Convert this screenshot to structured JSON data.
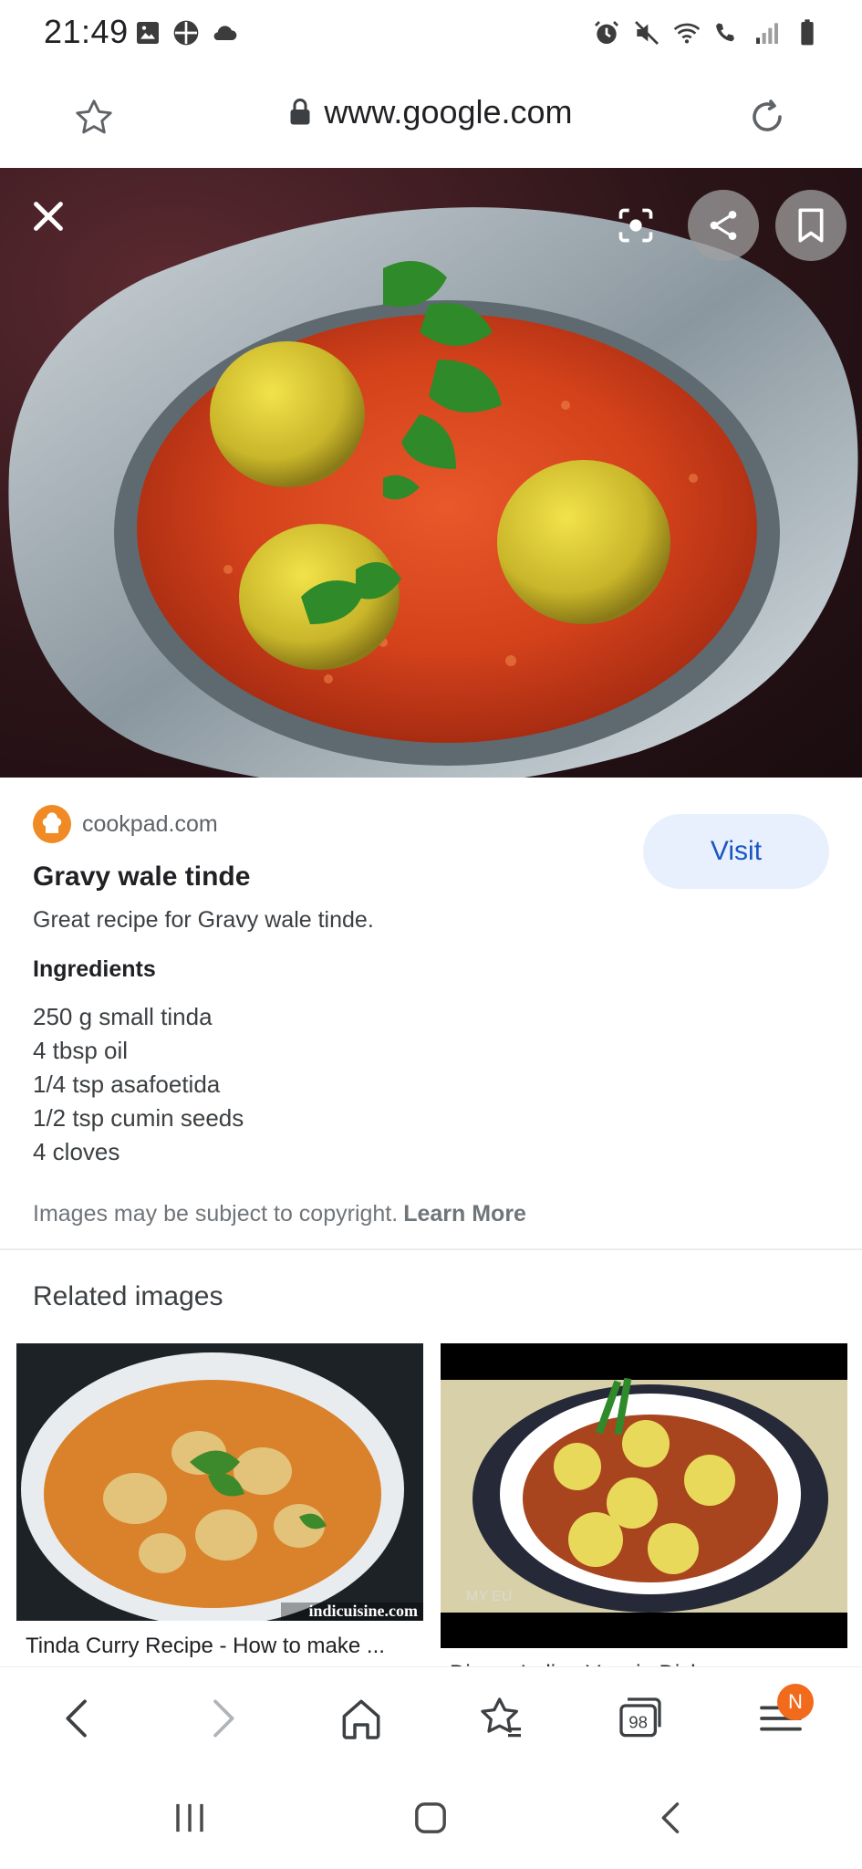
{
  "status_bar": {
    "time": "21:49",
    "icons": [
      "image-icon",
      "game-icon",
      "cloud-icon",
      "alarm-icon",
      "mute-icon",
      "wifi-icon",
      "wifi-call-icon",
      "signal-icon",
      "battery-icon"
    ]
  },
  "url_bar": {
    "url": "www.google.com"
  },
  "result": {
    "source_domain": "cookpad.com",
    "visit_label": "Visit",
    "title": "Gravy wale tinde",
    "description": "Great recipe for Gravy wale tinde.",
    "ingredients_heading": "Ingredients",
    "ingredients": [
      "250 g small tinda",
      "4 tbsp oil",
      "1/4 tsp asafoetida",
      "1/2 tsp cumin seeds",
      "4 cloves"
    ],
    "copyright_text": "Images may be subject to copyright.",
    "learn_more": "Learn More"
  },
  "related": {
    "heading": "Related images",
    "items": [
      {
        "caption": "Tinda Curry Recipe - How to make ...",
        "watermark": "indicuisine.com"
      },
      {
        "caption": "Dinner Indian Veggie Dish...",
        "watermark": "MY EU"
      }
    ]
  },
  "bottom_bar": {
    "tabs_count": "98",
    "menu_badge": "N"
  },
  "colors": {
    "visit_bg": "#e8f0fe",
    "visit_text": "#1a56c2",
    "badge": "#f26b1d",
    "favicon": "#f08a24"
  }
}
